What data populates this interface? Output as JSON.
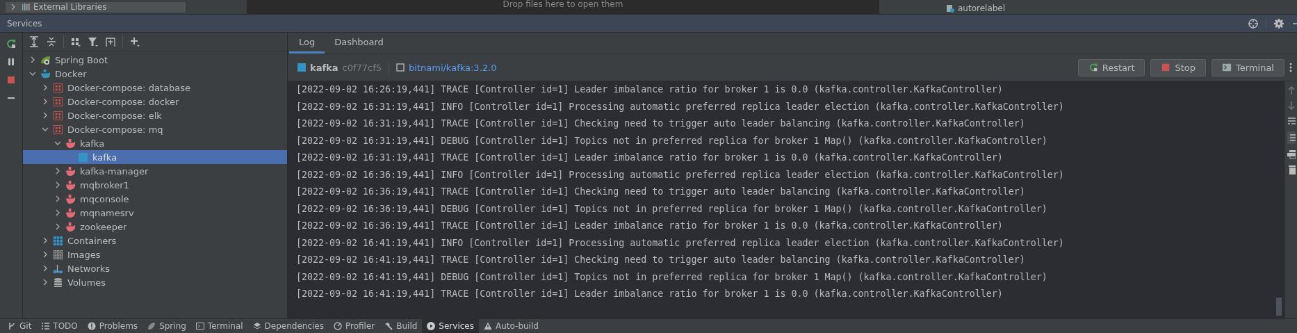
{
  "background": {
    "project_item": "External Libraries",
    "editor_hint": "Drop files here to open them",
    "file_item": "autorelabel"
  },
  "window": {
    "title": "Services"
  },
  "tree": [
    {
      "label": "Spring Boot",
      "kind": "spring",
      "expanded": false,
      "selected": false
    },
    {
      "label": "Docker",
      "kind": "docker",
      "expanded": true,
      "selected": false,
      "children": [
        {
          "label": "Docker-compose: database",
          "kind": "compose",
          "expanded": false,
          "selected": false
        },
        {
          "label": "Docker-compose: docker",
          "kind": "compose",
          "expanded": false,
          "selected": false
        },
        {
          "label": "Docker-compose: elk",
          "kind": "compose",
          "expanded": false,
          "selected": false
        },
        {
          "label": "Docker-compose: mq",
          "kind": "compose",
          "expanded": true,
          "selected": false,
          "children": [
            {
              "label": "kafka",
              "kind": "service",
              "expanded": true,
              "selected": false,
              "children": [
                {
                  "label": "kafka",
                  "kind": "container",
                  "selected": true
                }
              ]
            },
            {
              "label": "kafka-manager",
              "kind": "service",
              "expanded": false,
              "selected": false
            },
            {
              "label": "mqbroker1",
              "kind": "service",
              "expanded": false,
              "selected": false
            },
            {
              "label": "mqconsole",
              "kind": "service",
              "expanded": false,
              "selected": false
            },
            {
              "label": "mqnamesrv",
              "kind": "service",
              "expanded": false,
              "selected": false
            },
            {
              "label": "zookeeper",
              "kind": "service",
              "expanded": false,
              "selected": false
            }
          ]
        },
        {
          "label": "Containers",
          "kind": "containers",
          "expanded": false,
          "selected": false
        },
        {
          "label": "Images",
          "kind": "images",
          "expanded": false,
          "selected": false
        },
        {
          "label": "Networks",
          "kind": "networks",
          "expanded": false,
          "selected": false
        },
        {
          "label": "Volumes",
          "kind": "volumes",
          "expanded": false,
          "selected": false
        }
      ]
    }
  ],
  "tabs": [
    {
      "label": "Log",
      "selected": true
    },
    {
      "label": "Dashboard",
      "selected": false
    }
  ],
  "container": {
    "name": "kafka",
    "id": "c0f77cf5",
    "image": "bitnami/kafka:3.2.0"
  },
  "actions": [
    {
      "label": "Restart",
      "kind": "restart"
    },
    {
      "label": "Stop",
      "kind": "stop"
    },
    {
      "label": "Terminal",
      "kind": "terminal"
    }
  ],
  "log": [
    "[2022-09-02 16:26:19,441] TRACE [Controller id=1] Leader imbalance ratio for broker 1 is 0.0 (kafka.controller.KafkaController)",
    "[2022-09-02 16:31:19,441] INFO [Controller id=1] Processing automatic preferred replica leader election (kafka.controller.KafkaController)",
    "[2022-09-02 16:31:19,441] TRACE [Controller id=1] Checking need to trigger auto leader balancing (kafka.controller.KafkaController)",
    "[2022-09-02 16:31:19,441] DEBUG [Controller id=1] Topics not in preferred replica for broker 1 Map() (kafka.controller.KafkaController)",
    "[2022-09-02 16:31:19,441] TRACE [Controller id=1] Leader imbalance ratio for broker 1 is 0.0 (kafka.controller.KafkaController)",
    "[2022-09-02 16:36:19,441] INFO [Controller id=1] Processing automatic preferred replica leader election (kafka.controller.KafkaController)",
    "[2022-09-02 16:36:19,441] TRACE [Controller id=1] Checking need to trigger auto leader balancing (kafka.controller.KafkaController)",
    "[2022-09-02 16:36:19,441] DEBUG [Controller id=1] Topics not in preferred replica for broker 1 Map() (kafka.controller.KafkaController)",
    "[2022-09-02 16:36:19,441] TRACE [Controller id=1] Leader imbalance ratio for broker 1 is 0.0 (kafka.controller.KafkaController)",
    "[2022-09-02 16:41:19,441] INFO [Controller id=1] Processing automatic preferred replica leader election (kafka.controller.KafkaController)",
    "[2022-09-02 16:41:19,441] TRACE [Controller id=1] Checking need to trigger auto leader balancing (kafka.controller.KafkaController)",
    "[2022-09-02 16:41:19,441] DEBUG [Controller id=1] Topics not in preferred replica for broker 1 Map() (kafka.controller.KafkaController)",
    "[2022-09-02 16:41:19,441] TRACE [Controller id=1] Leader imbalance ratio for broker 1 is 0.0 (kafka.controller.KafkaController)"
  ],
  "tool_windows": [
    {
      "label": "Git",
      "kind": "git",
      "selected": false
    },
    {
      "label": "TODO",
      "kind": "todo",
      "selected": false
    },
    {
      "label": "Problems",
      "kind": "problems",
      "selected": false
    },
    {
      "label": "Spring",
      "kind": "spring",
      "selected": false
    },
    {
      "label": "Terminal",
      "kind": "terminal",
      "selected": false
    },
    {
      "label": "Dependencies",
      "kind": "dependencies",
      "selected": false
    },
    {
      "label": "Profiler",
      "kind": "profiler",
      "selected": false
    },
    {
      "label": "Build",
      "kind": "build",
      "selected": false
    },
    {
      "label": "Services",
      "kind": "services",
      "selected": true
    },
    {
      "label": "Auto-build",
      "kind": "warning",
      "selected": false
    }
  ]
}
